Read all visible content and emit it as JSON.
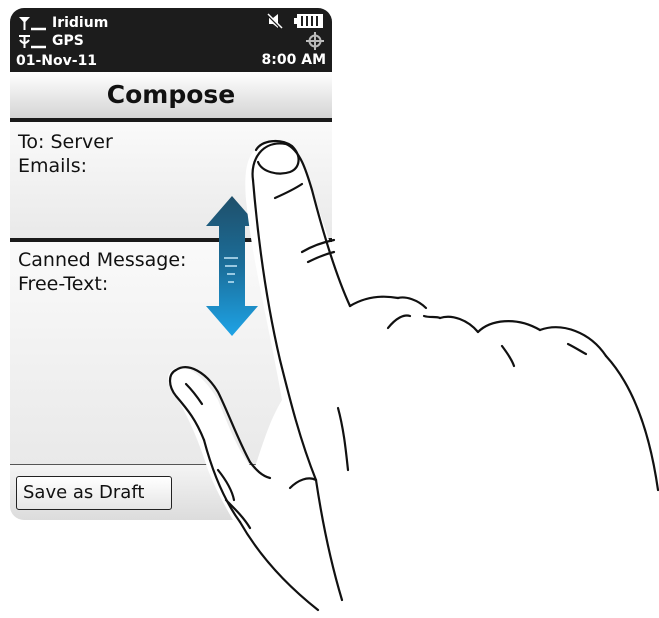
{
  "status_bar": {
    "network_label": "Iridium",
    "gps_label": "GPS",
    "date": "01-Nov-11",
    "time": "8:00 AM",
    "icons": {
      "network": "satellite-signal-icon",
      "gps": "gps-signal-icon",
      "mute": "speaker-muted-icon",
      "battery": "battery-icon",
      "gps_fix": "crosshair-icon"
    }
  },
  "screen": {
    "title": "Compose"
  },
  "fields": {
    "to_label": "To: Server",
    "emails_label": "Emails:",
    "canned_label": "Canned Message:",
    "freetext_label": "Free-Text:"
  },
  "buttons": {
    "save_draft": "Save as Draft"
  },
  "gesture": {
    "type": "two-finger vertical pinch/scroll",
    "arrow_colors": [
      "#1f4f6a",
      "#1ea3e6"
    ]
  }
}
